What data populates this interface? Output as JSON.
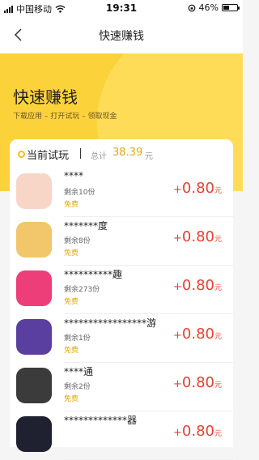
{
  "status_bar": {
    "carrier": "中国移动",
    "time": "19:31",
    "battery": "46%",
    "battery_level": 0.46
  },
  "nav": {
    "title": "快速赚钱"
  },
  "hero": {
    "title": "快速赚钱",
    "subtitle": "下载应用 – 打开试玩 – 领取现金"
  },
  "summary": {
    "title": "当前试玩",
    "total_label": "总计",
    "total_value": "38.39",
    "total_unit": "元"
  },
  "tasks": [
    {
      "name": "****",
      "remaining": "剩余10份",
      "price_tag": "免费",
      "plus": "+",
      "amount": "0.80",
      "unit": "元",
      "icon_color": "#f7d6c8"
    },
    {
      "name": "*******度",
      "remaining": "剩余8份",
      "price_tag": "免费",
      "plus": "+",
      "amount": "0.80",
      "unit": "元",
      "icon_color": "#f2c66a"
    },
    {
      "name": "**********趣",
      "remaining": "剩余273份",
      "price_tag": "免费",
      "plus": "+",
      "amount": "0.80",
      "unit": "元",
      "icon_color": "#ee3e7a"
    },
    {
      "name": "*****************游",
      "remaining": "剩余1份",
      "price_tag": "免费",
      "plus": "+",
      "amount": "0.80",
      "unit": "元",
      "icon_color": "#5b3fa0"
    },
    {
      "name": "****通",
      "remaining": "剩余2份",
      "price_tag": "免费",
      "plus": "+",
      "amount": "0.80",
      "unit": "元",
      "icon_color": "#3b3b3b"
    },
    {
      "name": "*************器",
      "remaining": "",
      "price_tag": "",
      "plus": "+",
      "amount": "0.80",
      "unit": "元",
      "icon_color": "#1f2030"
    }
  ]
}
